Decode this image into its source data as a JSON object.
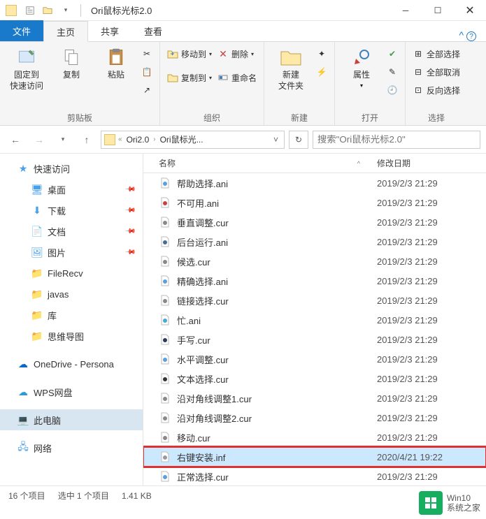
{
  "window": {
    "title": "Ori鼠标光标2.0"
  },
  "tabs": {
    "file": "文件",
    "home": "主页",
    "share": "共享",
    "view": "查看"
  },
  "ribbon": {
    "clipboard": {
      "pin": "固定到\n快速访问",
      "copy": "复制",
      "paste": "粘贴",
      "label": "剪贴板"
    },
    "organize": {
      "moveTo": "移动到",
      "copyTo": "复制到",
      "delete": "删除",
      "rename": "重命名",
      "label": "组织"
    },
    "new": {
      "newFolder": "新建\n文件夹",
      "label": "新建"
    },
    "open": {
      "properties": "属性",
      "label": "打开"
    },
    "select": {
      "selectAll": "全部选择",
      "selectNone": "全部取消",
      "invertSelection": "反向选择",
      "label": "选择"
    }
  },
  "address": {
    "seg1": "Ori2.0",
    "seg2": "Ori鼠标光..."
  },
  "search": {
    "placeholder": "搜索\"Ori鼠标光标2.0\""
  },
  "columns": {
    "name": "名称",
    "date": "修改日期"
  },
  "sidebar": {
    "quickAccess": "快速访问",
    "desktop": "桌面",
    "downloads": "下载",
    "documents": "文档",
    "pictures": "图片",
    "fileRecv": "FileRecv",
    "javas": "javas",
    "libraries": "库",
    "mindmap": "思维导图",
    "onedrive": "OneDrive - Persona",
    "wps": "WPS网盘",
    "thispc": "此电脑",
    "network": "网络"
  },
  "files": [
    {
      "name": "帮助选择.ani",
      "date": "2019/2/3 21:29",
      "iconColor": "#5aa0e0"
    },
    {
      "name": "不可用.ani",
      "date": "2019/2/3 21:29",
      "iconColor": "#c94040"
    },
    {
      "name": "垂直调整.cur",
      "date": "2019/2/3 21:29",
      "iconColor": "#888"
    },
    {
      "name": "后台运行.ani",
      "date": "2019/2/3 21:29",
      "iconColor": "#4a6a9a"
    },
    {
      "name": "候选.cur",
      "date": "2019/2/3 21:29",
      "iconColor": "#888"
    },
    {
      "name": "精确选择.ani",
      "date": "2019/2/3 21:29",
      "iconColor": "#5aa0e0"
    },
    {
      "name": "链接选择.cur",
      "date": "2019/2/3 21:29",
      "iconColor": "#888"
    },
    {
      "name": "忙.ani",
      "date": "2019/2/3 21:29",
      "iconColor": "#4aa8d8"
    },
    {
      "name": "手写.cur",
      "date": "2019/2/3 21:29",
      "iconColor": "#2a3a5a"
    },
    {
      "name": "水平调整.cur",
      "date": "2019/2/3 21:29",
      "iconColor": "#5aa0e0"
    },
    {
      "name": "文本选择.cur",
      "date": "2019/2/3 21:29",
      "iconColor": "#333"
    },
    {
      "name": "沿对角线调整1.cur",
      "date": "2019/2/3 21:29",
      "iconColor": "#888"
    },
    {
      "name": "沿对角线调整2.cur",
      "date": "2019/2/3 21:29",
      "iconColor": "#888"
    },
    {
      "name": "移动.cur",
      "date": "2019/2/3 21:29",
      "iconColor": "#888"
    },
    {
      "name": "右键安装.inf",
      "date": "2020/4/21 19:22",
      "iconColor": "#999",
      "highlighted": true
    },
    {
      "name": "正常选择.cur",
      "date": "2019/2/3 21:29",
      "iconColor": "#5aa0e0"
    }
  ],
  "status": {
    "items": "16 个项目",
    "selected": "选中 1 个项目",
    "size": "1.41 KB"
  },
  "watermark": {
    "line1": "Win10",
    "line2": "系统之家"
  }
}
